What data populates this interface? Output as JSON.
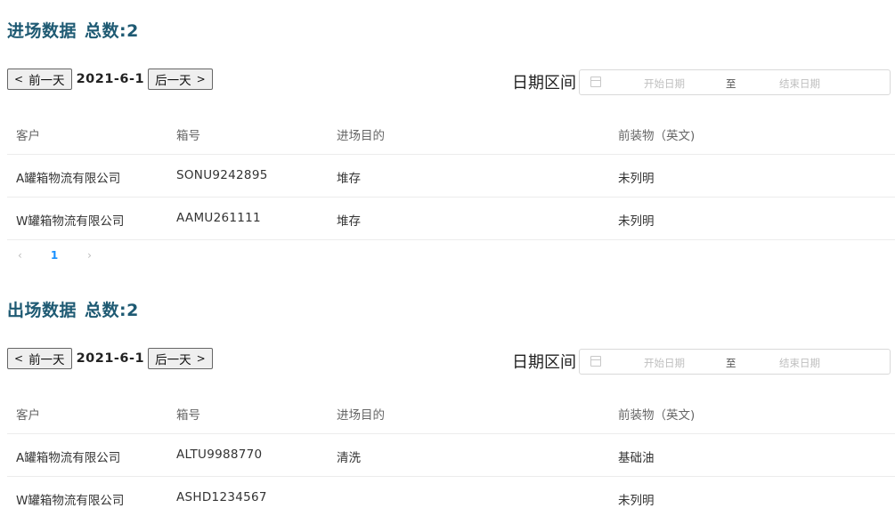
{
  "inbound": {
    "title": "进场数据",
    "total": "总数:2",
    "prev_day": "前一天",
    "current_date": "2021-6-1",
    "next_day": "后一天",
    "range_label": "日期区间",
    "range_start_placeholder": "开始日期",
    "range_separator": "至",
    "range_end_placeholder": "结束日期",
    "columns": [
      "客户",
      "箱号",
      "进场目的",
      "前装物（英文)"
    ],
    "rows": [
      [
        "A罐箱物流有限公司",
        "SONU9242895",
        "堆存",
        "未列明"
      ],
      [
        "W罐箱物流有限公司",
        "AAMU261111",
        "堆存",
        "未列明"
      ]
    ],
    "pagination": {
      "prev": "‹",
      "current_page": "1",
      "next": "›"
    }
  },
  "outbound": {
    "title": "出场数据",
    "total": "总数:2",
    "prev_day": "前一天",
    "current_date": "2021-6-1",
    "next_day": "后一天",
    "range_label": "日期区间",
    "range_start_placeholder": "开始日期",
    "range_separator": "至",
    "range_end_placeholder": "结束日期",
    "columns": [
      "客户",
      "箱号",
      "进场目的",
      "前装物（英文)"
    ],
    "rows": [
      [
        "A罐箱物流有限公司",
        "ALTU9988770",
        "清洗",
        "基础油"
      ],
      [
        "W罐箱物流有限公司",
        "ASHD1234567",
        "",
        "未列明"
      ]
    ]
  },
  "icons": {
    "prev": "chevron-left-icon",
    "next": "chevron-right-icon",
    "calendar": "calendar-icon"
  },
  "colors": {
    "title": "#1e5a73",
    "accent": "#1890ff"
  }
}
